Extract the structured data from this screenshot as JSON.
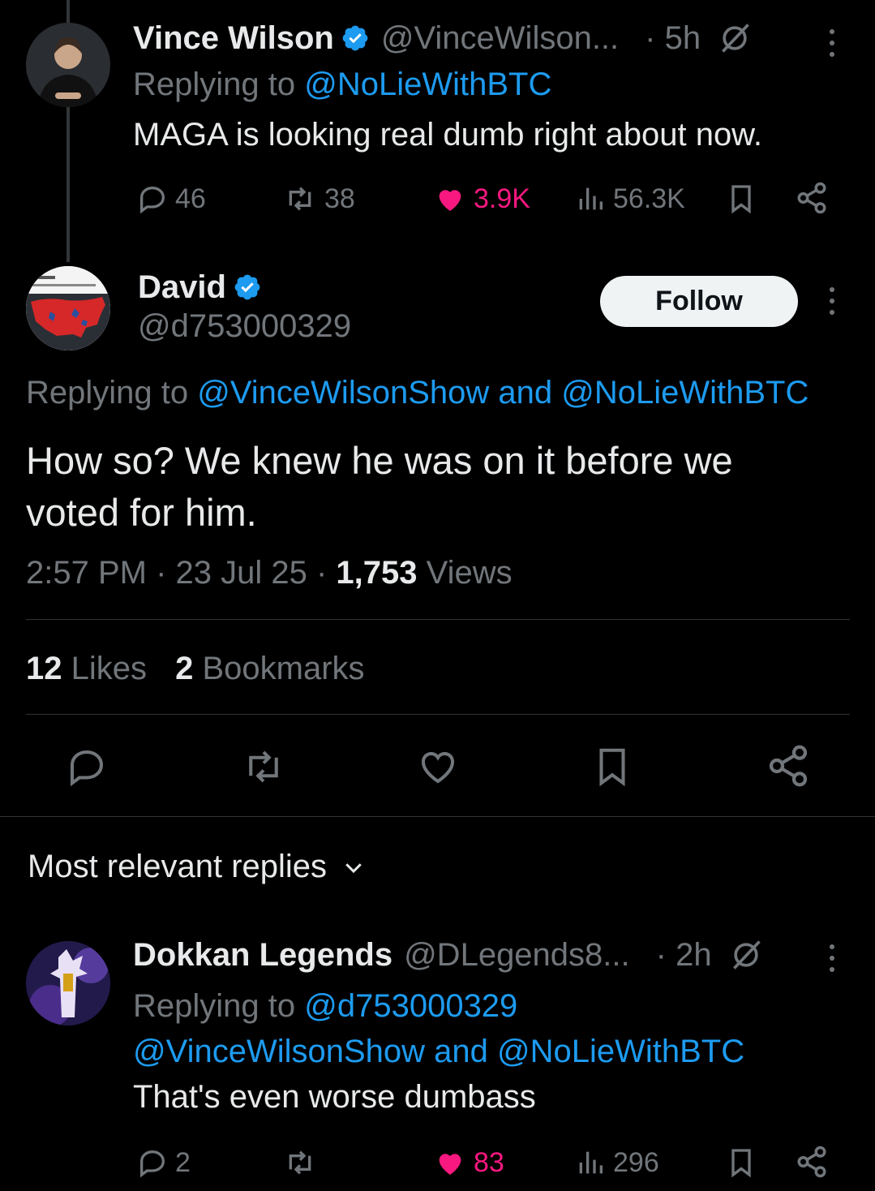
{
  "colors": {
    "background": "#000000",
    "text": "#e7e9ea",
    "muted": "#71767b",
    "link": "#1d9bf0",
    "like": "#f91880",
    "verified": "#1d9bf0",
    "divider": "#2f3336"
  },
  "parent_tweet": {
    "name": "Vince Wilson",
    "handle": "@VinceWilson...",
    "time": "· 5h",
    "replying_label": "Replying to ",
    "replying_to": "@NoLieWithBTC",
    "text": "MAGA is looking real dumb right about now.",
    "replies": "46",
    "reposts": "38",
    "likes": "3.9K",
    "views": "56.3K",
    "icons": [
      "verified-icon",
      "grok-slash-icon",
      "more-icon",
      "reply-icon",
      "repost-icon",
      "like-icon-filled",
      "views-icon",
      "bookmark-icon",
      "share-icon"
    ]
  },
  "main_tweet": {
    "name": "David",
    "handle": "@d753000329",
    "follow_label": "Follow",
    "replying_label": "Replying to ",
    "replying_to_1": "@VinceWilsonShow",
    "replying_and": " and ",
    "replying_to_2": "@NoLieWithBTC",
    "text_line1": "How so? We knew he was on it before we",
    "text_line2": "voted for him.",
    "timestamp": "2:57 PM · 23 Jul 25 · ",
    "views_count": "1,753",
    "views_label": " Views",
    "likes_count": "12",
    "likes_label": " Likes",
    "bookmarks_count": "2",
    "bookmarks_label": " Bookmarks"
  },
  "replies_sort": {
    "label": "Most relevant replies"
  },
  "reply_tweet": {
    "name": "Dokkan Legends",
    "handle": "@DLegends8...",
    "time": "· 2h",
    "replying_label": "Replying to ",
    "replying_to_1": "@d753000329",
    "replying_to_2": "@VinceWilsonShow",
    "replying_and": " and ",
    "replying_to_3": "@NoLieWithBTC",
    "text": "That's even worse dumbass",
    "replies": "2",
    "reposts": "",
    "likes": "83",
    "views": "296"
  }
}
